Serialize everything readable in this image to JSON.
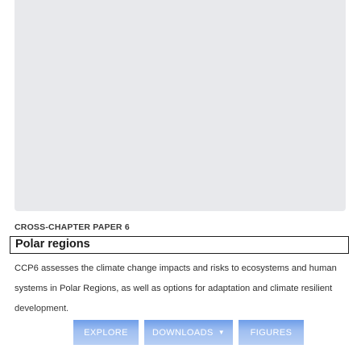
{
  "hero": {
    "background_color": "#e8e9ec"
  },
  "card": {
    "eyebrow": "CROSS-CHAPTER PAPER 6",
    "title": "Polar regions",
    "description": "CCP6 assesses the climate change impacts and risks to ecosystems and human systems in Polar Regions, as well as options for adaptation and climate resilient development."
  },
  "actions": {
    "explore_label": "EXPLORE",
    "downloads_label": "DOWNLOADS",
    "downloads_icon": "caret-down-icon",
    "figures_label": "FIGURES"
  },
  "colors": {
    "button_blue": "#2e73e0",
    "title_border": "#1f1f1f"
  }
}
